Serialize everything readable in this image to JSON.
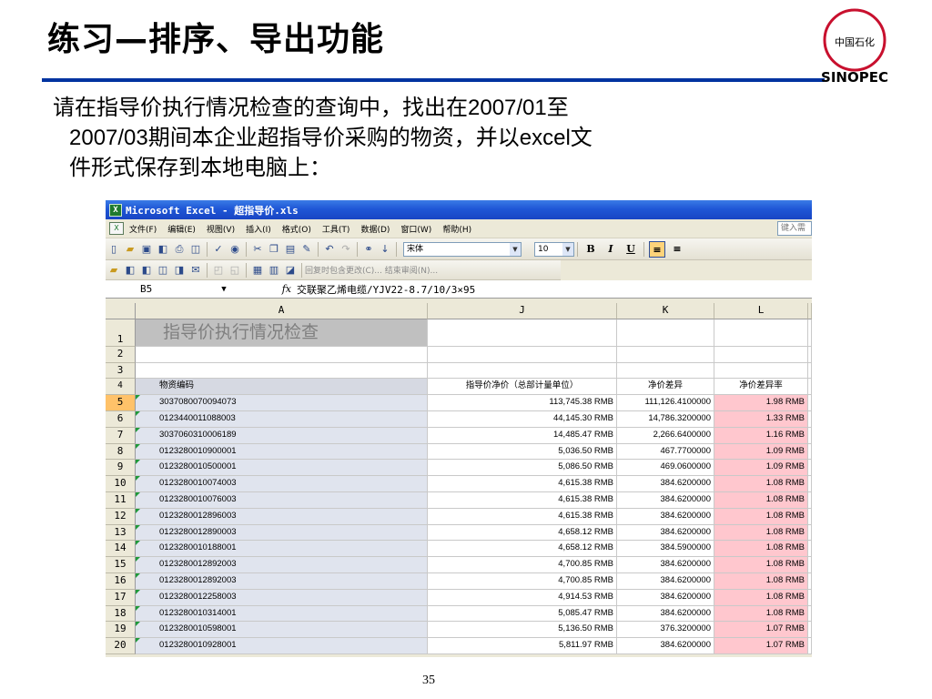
{
  "slide": {
    "title": "练习—排序、导出功能",
    "body": {
      "line1a": "请在指导价执行情况检查的查询中，找出在",
      "line1b": "2007/01",
      "line1c": "至",
      "line2a": "2007/03",
      "line2b": "期间本企业超指导价采购的物资，并以",
      "line2c": "excel",
      "line2d": "文",
      "line3": "件形式保存到本地电脑上："
    },
    "page_number": "35",
    "logo_text": "中国石化",
    "logo_brand": "SINOPEC"
  },
  "excel": {
    "title": "Microsoft Excel - 超指导价.xls",
    "menu": [
      "文件(F)",
      "编辑(E)",
      "视图(V)",
      "插入(I)",
      "格式(O)",
      "工具(T)",
      "数据(D)",
      "窗口(W)",
      "帮助(H)"
    ],
    "help_placeholder": "键入需",
    "font_name": "宋体",
    "font_size": "10",
    "format_buttons": [
      "B",
      "I",
      "U"
    ],
    "reply_toolbar_text": "回复时包含更改(C)...  结束审阅(N)...",
    "name_box": "B5",
    "formula_value": "交联聚乙烯电缆/YJV22-8.7/10/3×95",
    "columns": [
      "A",
      "J",
      "K",
      "L"
    ],
    "sheet_title": "指导价执行情况检查",
    "headers": {
      "A": "物资编码",
      "J": "指导价净价（总部计量单位）",
      "K": "净价差异",
      "L": "净价差异率"
    },
    "rows": [
      {
        "n": "5",
        "code": "3037080070094073",
        "price": "113,745.38 RMB",
        "diff": "111,126.4100000",
        "rate": "1.98 RMB"
      },
      {
        "n": "6",
        "code": "0123440011088003",
        "price": "44,145.30 RMB",
        "diff": "14,786.3200000",
        "rate": "1.33 RMB"
      },
      {
        "n": "7",
        "code": "3037060310006189",
        "price": "14,485.47 RMB",
        "diff": "2,266.6400000",
        "rate": "1.16 RMB"
      },
      {
        "n": "8",
        "code": "0123280010900001",
        "price": "5,036.50 RMB",
        "diff": "467.7700000",
        "rate": "1.09 RMB"
      },
      {
        "n": "9",
        "code": "0123280010500001",
        "price": "5,086.50 RMB",
        "diff": "469.0600000",
        "rate": "1.09 RMB"
      },
      {
        "n": "10",
        "code": "0123280010074003",
        "price": "4,615.38 RMB",
        "diff": "384.6200000",
        "rate": "1.08 RMB"
      },
      {
        "n": "11",
        "code": "0123280010076003",
        "price": "4,615.38 RMB",
        "diff": "384.6200000",
        "rate": "1.08 RMB"
      },
      {
        "n": "12",
        "code": "0123280012896003",
        "price": "4,615.38 RMB",
        "diff": "384.6200000",
        "rate": "1.08 RMB"
      },
      {
        "n": "13",
        "code": "0123280012890003",
        "price": "4,658.12 RMB",
        "diff": "384.6200000",
        "rate": "1.08 RMB"
      },
      {
        "n": "14",
        "code": "0123280010188001",
        "price": "4,658.12 RMB",
        "diff": "384.5900000",
        "rate": "1.08 RMB"
      },
      {
        "n": "15",
        "code": "0123280012892003",
        "price": "4,700.85 RMB",
        "diff": "384.6200000",
        "rate": "1.08 RMB"
      },
      {
        "n": "16",
        "code": "0123280012892003",
        "price": "4,700.85 RMB",
        "diff": "384.6200000",
        "rate": "1.08 RMB"
      },
      {
        "n": "17",
        "code": "0123280012258003",
        "price": "4,914.53 RMB",
        "diff": "384.6200000",
        "rate": "1.08 RMB"
      },
      {
        "n": "18",
        "code": "0123280010314001",
        "price": "5,085.47 RMB",
        "diff": "384.6200000",
        "rate": "1.08 RMB"
      },
      {
        "n": "19",
        "code": "0123280010598001",
        "price": "5,136.50 RMB",
        "diff": "376.3200000",
        "rate": "1.07 RMB"
      },
      {
        "n": "20",
        "code": "0123280010928001",
        "price": "5,811.97 RMB",
        "diff": "384.6200000",
        "rate": "1.07 RMB"
      }
    ],
    "colors": {
      "title_bar": "#1f57d6",
      "rate_fill": "#ffc7ce",
      "selected_row_header": "#ffc269",
      "title_cell_fill": "#c0c0c0",
      "code_cell_fill": "#e0e4ee"
    }
  }
}
